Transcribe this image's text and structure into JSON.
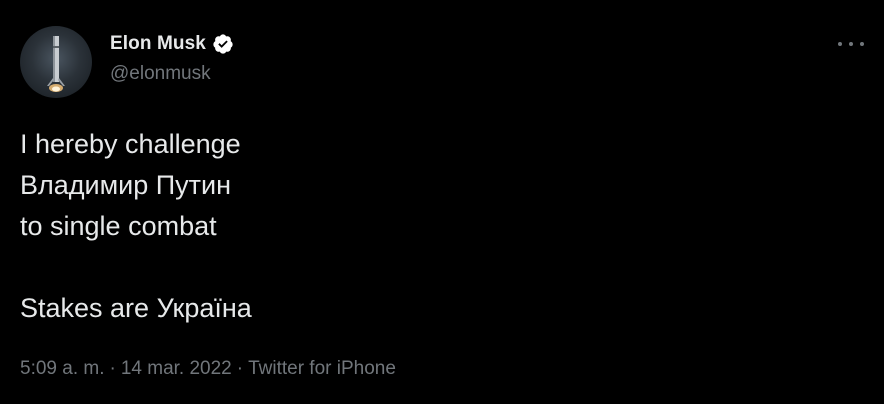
{
  "author": {
    "display_name": "Elon Musk",
    "handle": "@elonmusk",
    "verified": true,
    "avatar_icon": "rocket-launch-avatar"
  },
  "more_icon": "more-horizontal-icon",
  "tweet": {
    "lines": [
      "I hereby challenge",
      "Владимир Путин",
      "to single combat",
      "",
      "Stakes are Україна"
    ]
  },
  "meta": {
    "time": "5:09 a. m.",
    "separator": "·",
    "date": "14 mar. 2022",
    "source": "Twitter for iPhone"
  },
  "colors": {
    "background": "#000000",
    "primary_text": "#e7e9ea",
    "secondary_text": "#71767b",
    "verified_badge": "#ffffff"
  }
}
